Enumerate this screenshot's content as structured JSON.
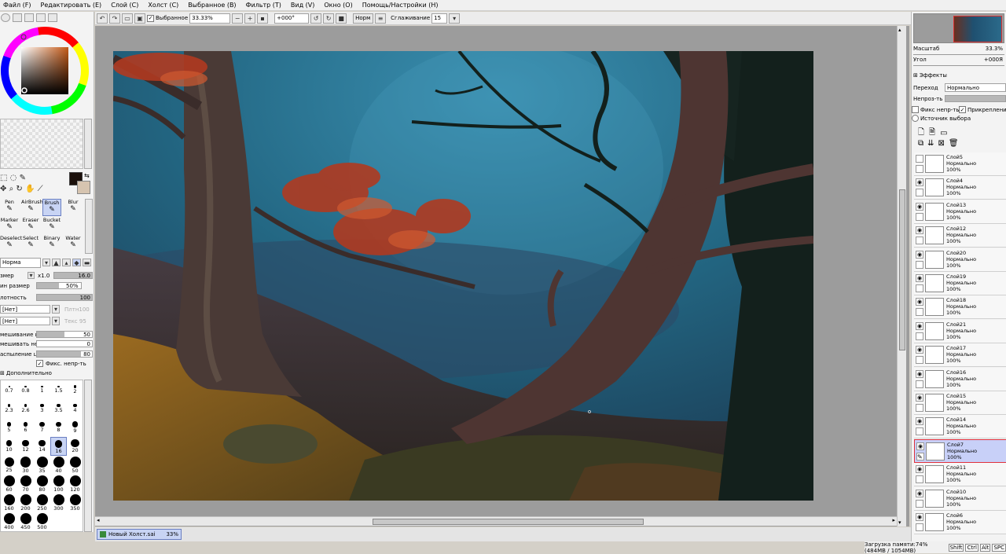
{
  "menu": [
    "Файл (F)",
    "Редактировать (E)",
    "Слой (C)",
    "Холст (C)",
    "Выбранное (B)",
    "Фильтр (T)",
    "Вид (V)",
    "Окно (O)",
    "Помощь/Настройки (H)"
  ],
  "toolbar": {
    "selected_label": "Выбранное",
    "zoom": "33.33%",
    "rotation": "+000°",
    "blend": "Норм",
    "smoothing_label": "Сглаживание",
    "smoothing_value": "15"
  },
  "left": {
    "tools": [
      {
        "label": "Pen",
        "icon": "pen-icon"
      },
      {
        "label": "AirBrush",
        "icon": "airbrush-icon"
      },
      {
        "label": "Brush",
        "icon": "brush-icon"
      },
      {
        "label": "Blur",
        "icon": "blur-icon"
      },
      {
        "label": "Marker",
        "icon": "marker-icon"
      },
      {
        "label": "Eraser",
        "icon": "eraser-icon"
      },
      {
        "label": "Bucket",
        "icon": "bucket-icon"
      },
      {
        "label": "",
        "icon": ""
      },
      {
        "label": "Deselect",
        "icon": "deselect-icon"
      },
      {
        "label": "Select",
        "icon": "select-icon"
      },
      {
        "label": "Binary",
        "icon": "binary-icon"
      },
      {
        "label": "Water",
        "icon": "water-icon"
      }
    ],
    "blend_mode": "Норма",
    "size_label": "змер",
    "size_mult": "x1.0",
    "size_value": "16.0",
    "min_size_label": "ин размер",
    "min_size_value": "50%",
    "density_label": "лотность",
    "density_value": "100",
    "shape1": "[Нет]",
    "shape1_value": "Плтн100",
    "shape2": "[Нет]",
    "shape2_value": "Текс 95",
    "mix_label": "мешивание цвет",
    "mix_value": "50",
    "dilute_label": "мешивать непрс",
    "dilute_value": "0",
    "persist_label": "аспыление цвет",
    "persist_value": "80",
    "fix_label": "Фикс. непр-ть",
    "advanced_label": "Дополнительно",
    "fix_percentage": 80,
    "brush_sizes": [
      "0.7",
      "0.8",
      "1",
      "1.5",
      "2",
      "2.3",
      "2.6",
      "3",
      "3.5",
      "4",
      "5",
      "6",
      "7",
      "8",
      "9",
      "10",
      "12",
      "14",
      "16",
      "20",
      "25",
      "30",
      "35",
      "40",
      "50",
      "60",
      "70",
      "80",
      "100",
      "120",
      "160",
      "200",
      "250",
      "300",
      "350",
      "400",
      "450",
      "500"
    ],
    "selected_size": "16",
    "fg_color": "#1a0f0a",
    "bg_color": "#d6c4b0"
  },
  "right": {
    "zoom_label": "Масштаб",
    "zoom_value": "33.3%",
    "angle_label": "Угол",
    "angle_value": "+000Я",
    "effects_label": "Эффекты",
    "mode_label": "Переход",
    "mode_value": "Нормально",
    "opacity_label": "Непроз-ть",
    "protect_label": "Фикс непр-ть",
    "clip_label": "Прикрепление сл",
    "source_label": "Источник выбора",
    "layers": [
      {
        "name": "Слой5",
        "mode": "Нормально",
        "opacity": "100%",
        "visible": false
      },
      {
        "name": "Слой4",
        "mode": "Нормально",
        "opacity": "100%",
        "visible": true
      },
      {
        "name": "Слой13",
        "mode": "Нормально",
        "opacity": "100%",
        "visible": true
      },
      {
        "name": "Слой12",
        "mode": "Нормально",
        "opacity": "100%",
        "visible": true
      },
      {
        "name": "Слой20",
        "mode": "Нормально",
        "opacity": "100%",
        "visible": true
      },
      {
        "name": "Слой19",
        "mode": "Нормально",
        "opacity": "100%",
        "visible": true
      },
      {
        "name": "Слой18",
        "mode": "Нормально",
        "opacity": "100%",
        "visible": true
      },
      {
        "name": "Слой21",
        "mode": "Нормально",
        "opacity": "100%",
        "visible": true
      },
      {
        "name": "Слой17",
        "mode": "Нормально",
        "opacity": "100%",
        "visible": true
      },
      {
        "name": "Слой16",
        "mode": "Нормально",
        "opacity": "100%",
        "visible": true
      },
      {
        "name": "Слой15",
        "mode": "Нормально",
        "opacity": "100%",
        "visible": true
      },
      {
        "name": "Слой14",
        "mode": "Нормально",
        "opacity": "100%",
        "visible": true
      },
      {
        "name": "Слой7",
        "mode": "Нормально",
        "opacity": "100%",
        "visible": true,
        "selected": true
      },
      {
        "name": "Слой11",
        "mode": "Нормально",
        "opacity": "100%",
        "visible": true
      },
      {
        "name": "Слой10",
        "mode": "Нормально",
        "opacity": "100%",
        "visible": true
      },
      {
        "name": "Слой6",
        "mode": "Нормально",
        "opacity": "100%",
        "visible": true
      }
    ]
  },
  "status": {
    "doc_name": "Новый Холст.sai",
    "doc_zoom": "33%",
    "memory": "Загрузка памяти:74% (484MB / 1054MB)",
    "keys": [
      "Shift",
      "Ctrl",
      "Alt",
      "SPC"
    ]
  }
}
